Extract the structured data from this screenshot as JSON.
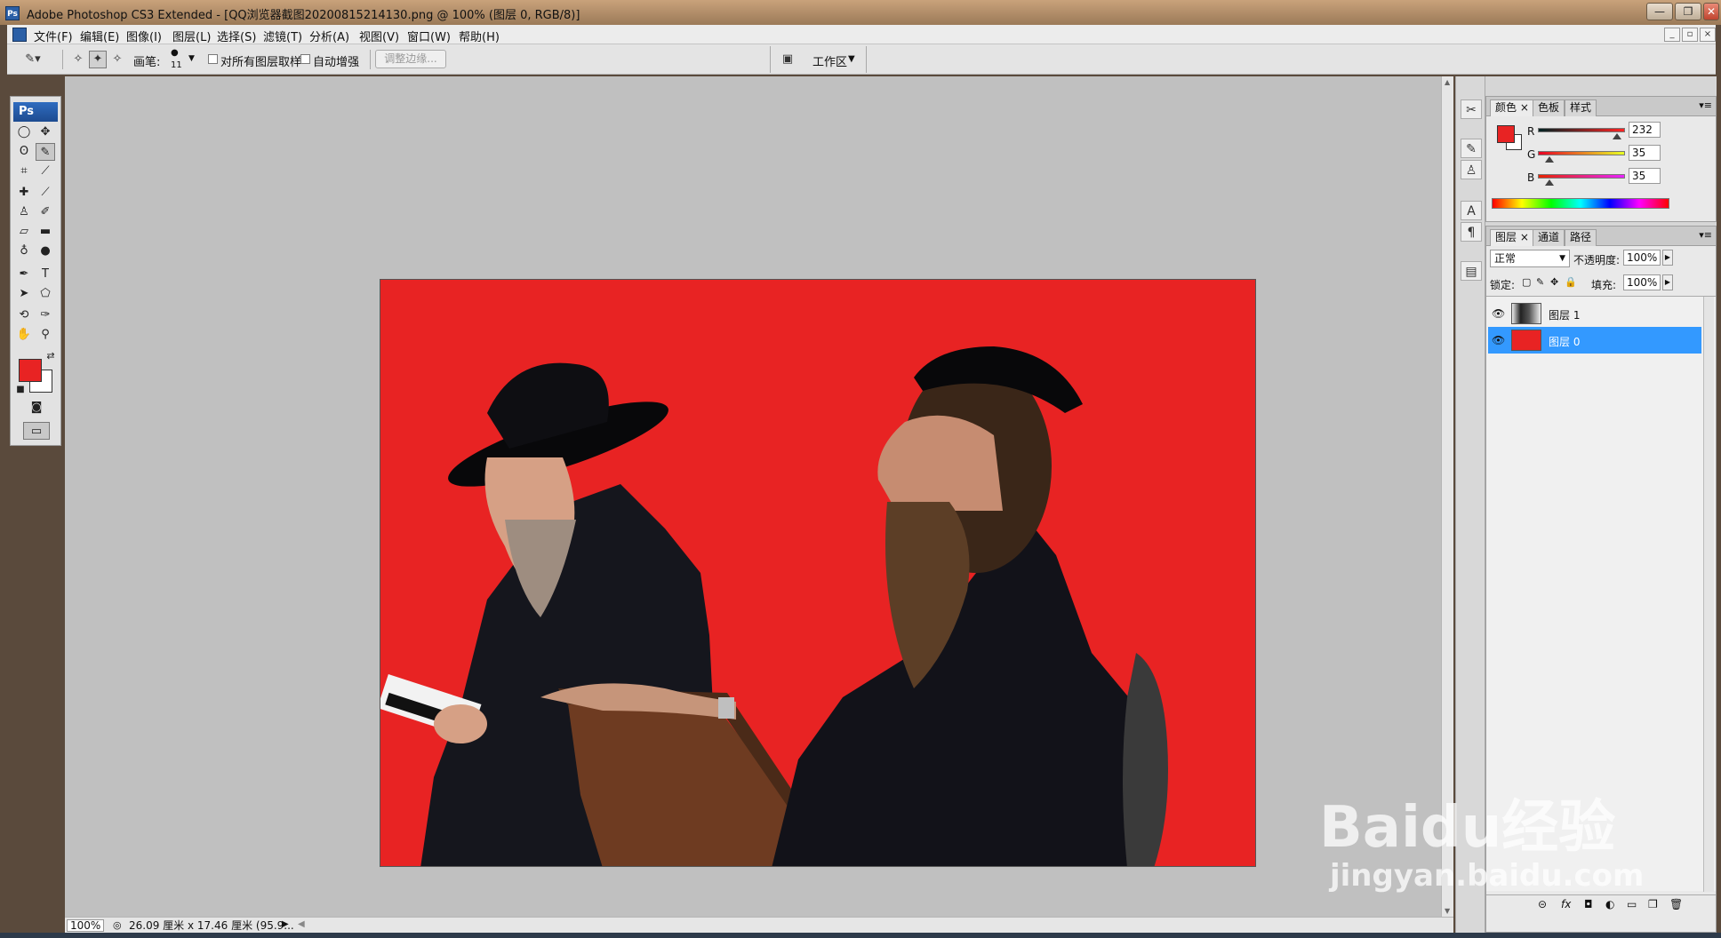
{
  "titlebar": {
    "title": "Adobe Photoshop CS3 Extended - [QQ浏览器截图20200815214130.png @ 100% (图层 0, RGB/8)]",
    "minimize": "—",
    "restore": "❐",
    "close": "✕"
  },
  "menubar": {
    "items": [
      "文件(F)",
      "编辑(E)",
      "图像(I)",
      "图层(L)",
      "选择(S)",
      "滤镜(T)",
      "分析(A)",
      "视图(V)",
      "窗口(W)",
      "帮助(H)"
    ]
  },
  "options": {
    "brush_label": "画笔:",
    "brush_size": "11",
    "sample_all_layers": "对所有图层取样",
    "auto_enhance": "自动增强",
    "refine_edge": "调整边缘...",
    "workspace": "工作区"
  },
  "toolbox": {
    "logo": "Ps"
  },
  "document": {
    "background_color": "#e82323"
  },
  "statusbar": {
    "zoom": "100%",
    "doc_info": "26.09 厘米 x 17.46 厘米 (95.9..."
  },
  "color_panel": {
    "tabs": [
      "颜色",
      "色板",
      "样式"
    ],
    "r_label": "R",
    "g_label": "G",
    "b_label": "B",
    "r": "232",
    "g": "35",
    "b": "35",
    "foreground": "#e82323",
    "background": "#ffffff"
  },
  "layers_panel": {
    "tabs": [
      "图层",
      "通道",
      "路径"
    ],
    "blend_mode": "正常",
    "opacity_label": "不透明度:",
    "opacity": "100%",
    "lock_label": "锁定:",
    "fill_label": "填充:",
    "fill": "100%",
    "layers": [
      {
        "name": "图层 1",
        "selected": false
      },
      {
        "name": "图层 0",
        "selected": true
      }
    ],
    "footer_icons": [
      "link-icon",
      "fx-icon",
      "mask-icon",
      "adjustment-icon",
      "group-icon",
      "new-layer-icon",
      "trash-icon"
    ]
  },
  "watermark": {
    "brand": "Baidu经验",
    "url": "jingyan.baidu.com"
  }
}
